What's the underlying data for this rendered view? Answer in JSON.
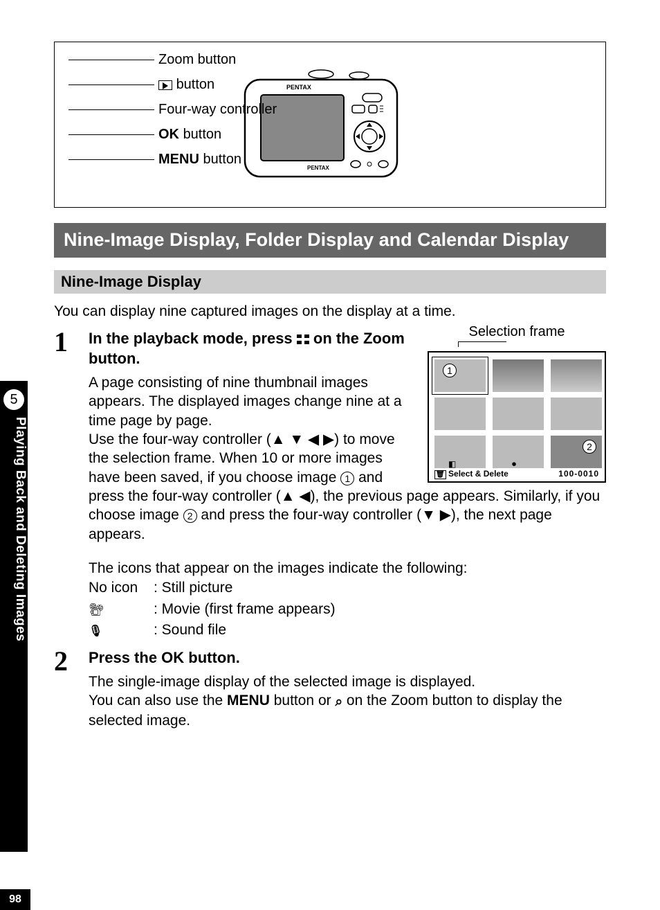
{
  "diagram": {
    "labels": {
      "zoom": "Zoom button",
      "playback": "button",
      "fourway": "Four-way controller",
      "ok_prefix": "OK",
      "ok_suffix": "button",
      "menu_prefix": "MENU",
      "menu_suffix": "button"
    },
    "brand": "PENTAX"
  },
  "section_title": "Nine-Image Display, Folder Display and Calendar Display",
  "subsection_title": "Nine-Image Display",
  "intro": "You can display nine captured images on the display at a time.",
  "step1": {
    "num": "1",
    "heading_a": "In the playback mode, press ",
    "heading_b": " on the Zoom button.",
    "selection_frame_label": "Selection frame",
    "body_1": "A page consisting of nine thumbnail images appears. The displayed images change nine at a time page by page.",
    "body_2a": "Use the four-way controller (",
    "body_2b": ") to move the selection frame. When 10 or more images have been saved, if you choose image ",
    "body_2c": " and press the four-way controller (",
    "body_2d": "), the previous page appears. Similarly, if you choose image ",
    "body_2e": " and press the four-way controller (",
    "body_2f": "), the next page appears.",
    "arrows_all": "▲ ▼ ◀ ▶",
    "arrows_ul": "▲ ◀",
    "arrows_dr": "▼ ▶",
    "circ1": "1",
    "circ2": "2",
    "icons_intro": "The icons that appear on the images indicate the following:",
    "legend_none_left": "No icon",
    "legend_none_right": ": Still picture",
    "legend_movie": ": Movie (first frame appears)",
    "legend_sound": ": Sound file",
    "lcd_footer_left": "Select & Delete",
    "lcd_footer_right": "100-0010"
  },
  "step2": {
    "num": "2",
    "heading_a": "Press the ",
    "heading_ok": "OK",
    "heading_b": " button.",
    "body_1": "The single-image display of the selected image is displayed.",
    "body_2a": "You can also use the ",
    "body_menu": "MENU",
    "body_2b": " button or ",
    "body_2c": " on the Zoom button to display the selected image."
  },
  "sidebar": {
    "chapter": "5",
    "label": "Playing Back and Deleting Images"
  },
  "page_number": "98"
}
